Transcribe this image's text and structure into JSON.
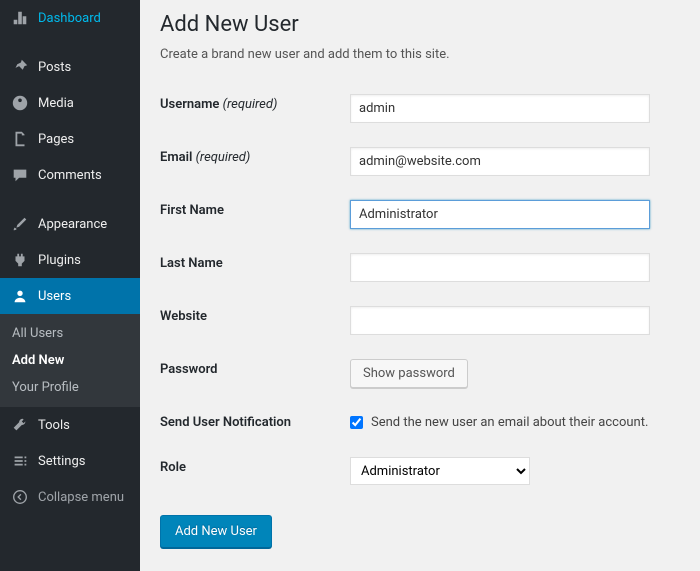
{
  "sidebar": {
    "dashboard": "Dashboard",
    "posts": "Posts",
    "media": "Media",
    "pages": "Pages",
    "comments": "Comments",
    "appearance": "Appearance",
    "plugins": "Plugins",
    "users": "Users",
    "users_sub": {
      "all_users": "All Users",
      "add_new": "Add New",
      "your_profile": "Your Profile"
    },
    "tools": "Tools",
    "settings": "Settings",
    "collapse": "Collapse menu"
  },
  "page": {
    "title": "Add New User",
    "subtitle": "Create a brand new user and add them to this site."
  },
  "form": {
    "username_label": "Username",
    "username_required": "(required)",
    "username_value": "admin",
    "email_label": "Email",
    "email_required": "(required)",
    "email_value": "admin@website.com",
    "first_name_label": "First Name",
    "first_name_value": "Administrator",
    "last_name_label": "Last Name",
    "last_name_value": "",
    "website_label": "Website",
    "website_value": "",
    "password_label": "Password",
    "password_button": "Show password",
    "notify_label": "Send User Notification",
    "notify_checkbox_label": "Send the new user an email about their account.",
    "notify_checked": true,
    "role_label": "Role",
    "role_value": "Administrator",
    "submit": "Add New User"
  }
}
